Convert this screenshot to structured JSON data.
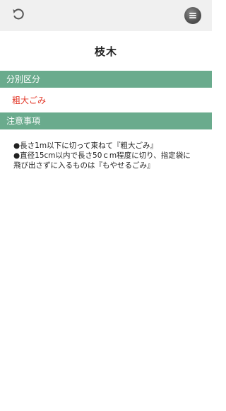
{
  "header": {
    "back_icon": "undo-arrow-icon",
    "menu_icon": "hamburger-menu-icon"
  },
  "page": {
    "title": "枝木"
  },
  "classification": {
    "header": "分別区分",
    "value": "粗大ごみ",
    "value_color": "#e33b2c"
  },
  "notes": {
    "header": "注意事項",
    "lines": [
      "●長さ1m以下に切って束ねて『粗大ごみ』",
      "●直径15cm以内で長さ50ｃm程度に切り、指定袋に飛び出さずに入るものは『もやせるごみ』"
    ]
  },
  "colors": {
    "section_header_bg": "#6aab8d",
    "topbar_bg": "#f0f0f0"
  }
}
